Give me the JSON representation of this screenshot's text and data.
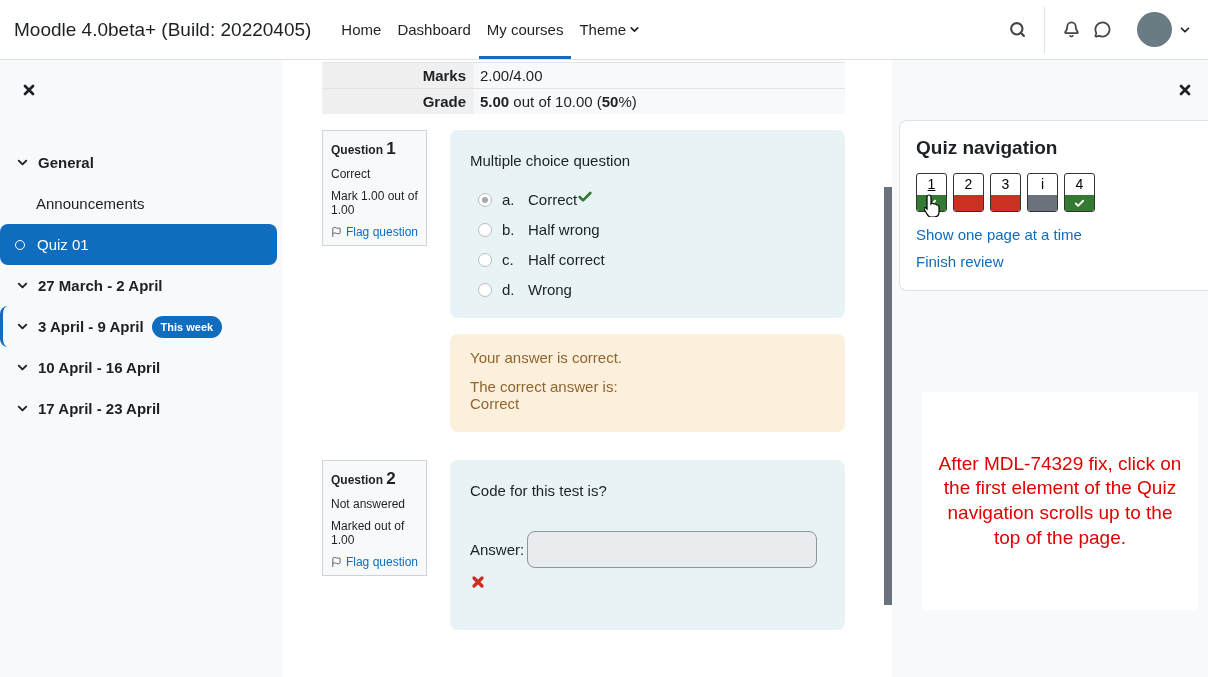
{
  "header": {
    "brand": "Moodle 4.0beta+ (Build: 20220405)",
    "nav": [
      {
        "label": "Home",
        "selected": false,
        "kind": "link"
      },
      {
        "label": "Dashboard",
        "selected": false,
        "kind": "link"
      },
      {
        "label": "My courses",
        "selected": true,
        "kind": "link"
      },
      {
        "label": "Theme",
        "selected": false,
        "kind": "dropdown"
      }
    ]
  },
  "sidebar": {
    "items": [
      {
        "kind": "section",
        "label": "General",
        "expanded": true,
        "current": false
      },
      {
        "kind": "activity",
        "label": "Announcements",
        "selected": false
      },
      {
        "kind": "activity",
        "label": "Quiz 01",
        "selected": true
      },
      {
        "kind": "section",
        "label": "27 March - 2 April",
        "expanded": true,
        "current": false
      },
      {
        "kind": "section",
        "label": "3 April - 9 April",
        "expanded": true,
        "current": true,
        "badge": "This week"
      },
      {
        "kind": "section",
        "label": "10 April - 16 April",
        "expanded": true,
        "current": false
      },
      {
        "kind": "section",
        "label": "17 April - 23 April",
        "expanded": true,
        "current": false
      }
    ]
  },
  "summary": [
    {
      "label": "Marks",
      "value": "2.00/4.00"
    },
    {
      "label": "Grade",
      "value": "**5.00** out of 10.00 (**50**%)"
    }
  ],
  "questions": [
    {
      "kind": "multichoice",
      "label": "Question",
      "number": "1",
      "state": "Correct",
      "mark": "Mark 1.00 out of 1.00",
      "flag": "Flag question",
      "text": "Multiple choice question",
      "options": [
        {
          "letter": "a.",
          "label": "Correct",
          "selected": true,
          "correct": true
        },
        {
          "letter": "b.",
          "label": "Half wrong",
          "selected": false,
          "correct": false
        },
        {
          "letter": "c.",
          "label": "Half correct",
          "selected": false,
          "correct": false
        },
        {
          "letter": "d.",
          "label": "Wrong",
          "selected": false,
          "correct": false
        }
      ],
      "feedback": {
        "general": "Your answer is correct.",
        "right_answer_label": "The correct answer is:",
        "right_answer": "Correct"
      }
    },
    {
      "kind": "shortanswer",
      "label": "Question",
      "number": "2",
      "state": "Not answered",
      "mark": "Marked out of 1.00",
      "flag": "Flag question",
      "text": "Code for this test is?",
      "answer_label": "Answer:",
      "correct": false
    }
  ],
  "quiz_navigation": {
    "title": "Quiz navigation",
    "buttons": [
      {
        "label": "1",
        "kind": "correct",
        "selected": true
      },
      {
        "label": "2",
        "kind": "incorrect",
        "selected": false
      },
      {
        "label": "3",
        "kind": "incorrect",
        "selected": false
      },
      {
        "label": "i",
        "kind": "info",
        "selected": false
      },
      {
        "label": "4",
        "kind": "correct",
        "selected": false
      }
    ],
    "links": [
      "Show one page at a time",
      "Finish review"
    ]
  },
  "annotation": {
    "text": "After MDL-74329 fix, click on the first element of the Quiz navigation scrolls up to the top of the page."
  }
}
